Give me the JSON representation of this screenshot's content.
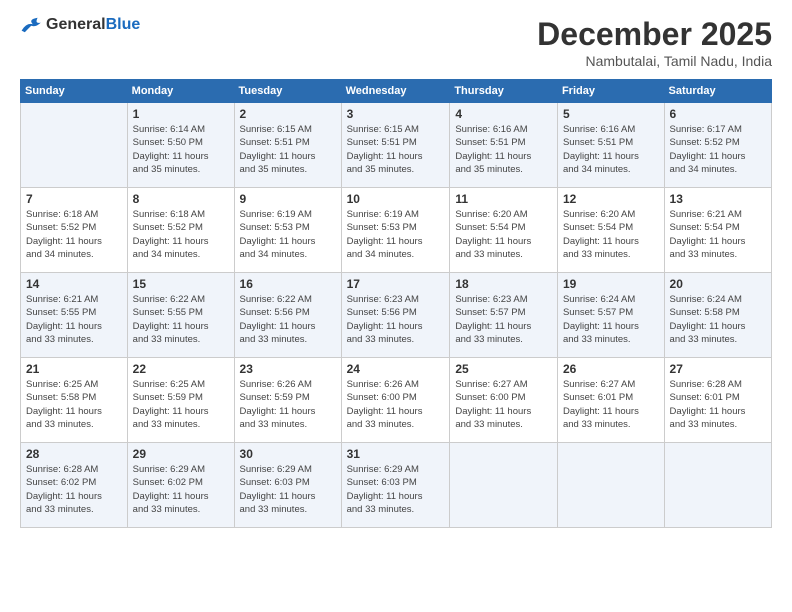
{
  "logo": {
    "general": "General",
    "blue": "Blue"
  },
  "header": {
    "month": "December 2025",
    "location": "Nambutalai, Tamil Nadu, India"
  },
  "days_of_week": [
    "Sunday",
    "Monday",
    "Tuesday",
    "Wednesday",
    "Thursday",
    "Friday",
    "Saturday"
  ],
  "weeks": [
    [
      {
        "day": "",
        "info": ""
      },
      {
        "day": "1",
        "info": "Sunrise: 6:14 AM\nSunset: 5:50 PM\nDaylight: 11 hours\nand 35 minutes."
      },
      {
        "day": "2",
        "info": "Sunrise: 6:15 AM\nSunset: 5:51 PM\nDaylight: 11 hours\nand 35 minutes."
      },
      {
        "day": "3",
        "info": "Sunrise: 6:15 AM\nSunset: 5:51 PM\nDaylight: 11 hours\nand 35 minutes."
      },
      {
        "day": "4",
        "info": "Sunrise: 6:16 AM\nSunset: 5:51 PM\nDaylight: 11 hours\nand 35 minutes."
      },
      {
        "day": "5",
        "info": "Sunrise: 6:16 AM\nSunset: 5:51 PM\nDaylight: 11 hours\nand 34 minutes."
      },
      {
        "day": "6",
        "info": "Sunrise: 6:17 AM\nSunset: 5:52 PM\nDaylight: 11 hours\nand 34 minutes."
      }
    ],
    [
      {
        "day": "7",
        "info": "Sunrise: 6:18 AM\nSunset: 5:52 PM\nDaylight: 11 hours\nand 34 minutes."
      },
      {
        "day": "8",
        "info": "Sunrise: 6:18 AM\nSunset: 5:52 PM\nDaylight: 11 hours\nand 34 minutes."
      },
      {
        "day": "9",
        "info": "Sunrise: 6:19 AM\nSunset: 5:53 PM\nDaylight: 11 hours\nand 34 minutes."
      },
      {
        "day": "10",
        "info": "Sunrise: 6:19 AM\nSunset: 5:53 PM\nDaylight: 11 hours\nand 34 minutes."
      },
      {
        "day": "11",
        "info": "Sunrise: 6:20 AM\nSunset: 5:54 PM\nDaylight: 11 hours\nand 33 minutes."
      },
      {
        "day": "12",
        "info": "Sunrise: 6:20 AM\nSunset: 5:54 PM\nDaylight: 11 hours\nand 33 minutes."
      },
      {
        "day": "13",
        "info": "Sunrise: 6:21 AM\nSunset: 5:54 PM\nDaylight: 11 hours\nand 33 minutes."
      }
    ],
    [
      {
        "day": "14",
        "info": "Sunrise: 6:21 AM\nSunset: 5:55 PM\nDaylight: 11 hours\nand 33 minutes."
      },
      {
        "day": "15",
        "info": "Sunrise: 6:22 AM\nSunset: 5:55 PM\nDaylight: 11 hours\nand 33 minutes."
      },
      {
        "day": "16",
        "info": "Sunrise: 6:22 AM\nSunset: 5:56 PM\nDaylight: 11 hours\nand 33 minutes."
      },
      {
        "day": "17",
        "info": "Sunrise: 6:23 AM\nSunset: 5:56 PM\nDaylight: 11 hours\nand 33 minutes."
      },
      {
        "day": "18",
        "info": "Sunrise: 6:23 AM\nSunset: 5:57 PM\nDaylight: 11 hours\nand 33 minutes."
      },
      {
        "day": "19",
        "info": "Sunrise: 6:24 AM\nSunset: 5:57 PM\nDaylight: 11 hours\nand 33 minutes."
      },
      {
        "day": "20",
        "info": "Sunrise: 6:24 AM\nSunset: 5:58 PM\nDaylight: 11 hours\nand 33 minutes."
      }
    ],
    [
      {
        "day": "21",
        "info": "Sunrise: 6:25 AM\nSunset: 5:58 PM\nDaylight: 11 hours\nand 33 minutes."
      },
      {
        "day": "22",
        "info": "Sunrise: 6:25 AM\nSunset: 5:59 PM\nDaylight: 11 hours\nand 33 minutes."
      },
      {
        "day": "23",
        "info": "Sunrise: 6:26 AM\nSunset: 5:59 PM\nDaylight: 11 hours\nand 33 minutes."
      },
      {
        "day": "24",
        "info": "Sunrise: 6:26 AM\nSunset: 6:00 PM\nDaylight: 11 hours\nand 33 minutes."
      },
      {
        "day": "25",
        "info": "Sunrise: 6:27 AM\nSunset: 6:00 PM\nDaylight: 11 hours\nand 33 minutes."
      },
      {
        "day": "26",
        "info": "Sunrise: 6:27 AM\nSunset: 6:01 PM\nDaylight: 11 hours\nand 33 minutes."
      },
      {
        "day": "27",
        "info": "Sunrise: 6:28 AM\nSunset: 6:01 PM\nDaylight: 11 hours\nand 33 minutes."
      }
    ],
    [
      {
        "day": "28",
        "info": "Sunrise: 6:28 AM\nSunset: 6:02 PM\nDaylight: 11 hours\nand 33 minutes."
      },
      {
        "day": "29",
        "info": "Sunrise: 6:29 AM\nSunset: 6:02 PM\nDaylight: 11 hours\nand 33 minutes."
      },
      {
        "day": "30",
        "info": "Sunrise: 6:29 AM\nSunset: 6:03 PM\nDaylight: 11 hours\nand 33 minutes."
      },
      {
        "day": "31",
        "info": "Sunrise: 6:29 AM\nSunset: 6:03 PM\nDaylight: 11 hours\nand 33 minutes."
      },
      {
        "day": "",
        "info": ""
      },
      {
        "day": "",
        "info": ""
      },
      {
        "day": "",
        "info": ""
      }
    ]
  ]
}
